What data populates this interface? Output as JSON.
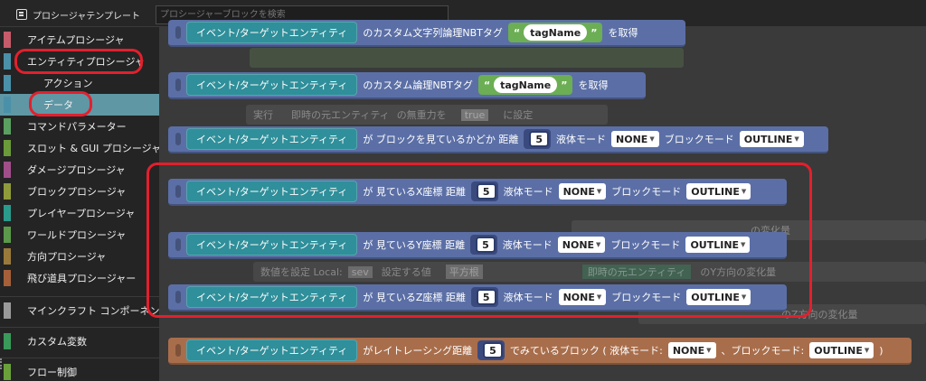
{
  "topbar": {
    "template_label": "プロシージャテンプレート",
    "search_placeholder": "プロシージャーブロックを検索"
  },
  "sidebar": {
    "items": [
      {
        "label": "アイテムプロシージャ",
        "color": "#c75b6a"
      },
      {
        "label": "エンティティプロシージャ",
        "color": "#4a90a8"
      },
      {
        "label": "アクション",
        "color": "#4a90a8"
      },
      {
        "label": "データ",
        "color": "#4a90a8"
      },
      {
        "label": "コマンドパラメーター",
        "color": "#5aa060"
      },
      {
        "label": "スロット & GUI プロシージャ",
        "color": "#6a9a3a"
      },
      {
        "label": "ダメージプロシージャ",
        "color": "#a04e8a"
      },
      {
        "label": "ブロックプロシージャ",
        "color": "#8f9a3a"
      },
      {
        "label": "プレイヤープロシージャ",
        "color": "#2a9a8a"
      },
      {
        "label": "ワールドプロシージャ",
        "color": "#5a9a4a"
      },
      {
        "label": "方向プロシージャ",
        "color": "#9a7a3a"
      },
      {
        "label": "飛び道具プロシージャー",
        "color": "#a5603a"
      },
      {
        "label": "マインクラフト コンポーネント",
        "color": "#9a9a9a"
      },
      {
        "label": "カスタム変数",
        "color": "#3a9a5a"
      },
      {
        "label": "フロー制御",
        "color": "#6aa03a"
      }
    ]
  },
  "ghosts": {
    "g1": "実行",
    "g2": "即時の元エンティティ",
    "g3": "の無重力を",
    "g4": "true",
    "g5": "に設定",
    "g6": "数値を設定 Local:",
    "g7": "sev",
    "g8": "設定する値",
    "g9": "平方根",
    "g10": "即時の元エンティティ",
    "g11": "のY方向の変化量",
    "g12": "の変化量",
    "g13": "のZ方向の変化量"
  },
  "blocks": {
    "entity_label": "イベント/ターゲットエンティティ",
    "b1": {
      "pre": "のカスタム文字列論理NBTタグ",
      "tag": "tagName",
      "post": "を取得"
    },
    "b2": {
      "pre": "のカスタム論理NBTタグ",
      "tag": "tagName",
      "post": "を取得"
    },
    "b3": {
      "pre": "が ブロックを見ているかどか 距離",
      "num": "5",
      "fluid": "液体モード",
      "fluid_val": "NONE",
      "block": "ブロックモード",
      "block_val": "OUTLINE"
    },
    "b4": {
      "pre": "が 見ているX座標 距離",
      "num": "5",
      "fluid": "液体モード",
      "fluid_val": "NONE",
      "block": "ブロックモード",
      "block_val": "OUTLINE"
    },
    "b5": {
      "pre": "が 見ているY座標 距離",
      "num": "5",
      "fluid": "液体モード",
      "fluid_val": "NONE",
      "block": "ブロックモード",
      "block_val": "OUTLINE"
    },
    "b6": {
      "pre": "が 見ているZ座標 距離",
      "num": "5",
      "fluid": "液体モード",
      "fluid_val": "NONE",
      "block": "ブロックモード",
      "block_val": "OUTLINE"
    },
    "b7": {
      "pre": "がレイトレーシング距離",
      "num": "5",
      "mid": "でみているブロック ( 液体モード:",
      "fluid_val": "NONE",
      "sep": "、ブロックモード:",
      "block_val": "OUTLINE",
      "close": ")"
    }
  },
  "colors": {
    "highlight": "#e2202d",
    "selected_bg": "#5f97a5",
    "block_blue": "#5b6fa6",
    "block_orange": "#a86e4c",
    "entity_teal": "#2f8f9a"
  }
}
